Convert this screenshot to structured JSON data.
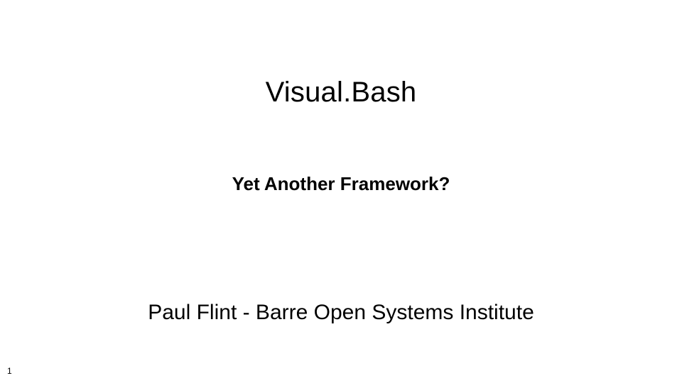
{
  "slide": {
    "title": "Visual.Bash",
    "subtitle": "Yet Another Framework?",
    "author": "Paul Flint - Barre Open Systems Institute",
    "page_number": "1"
  }
}
